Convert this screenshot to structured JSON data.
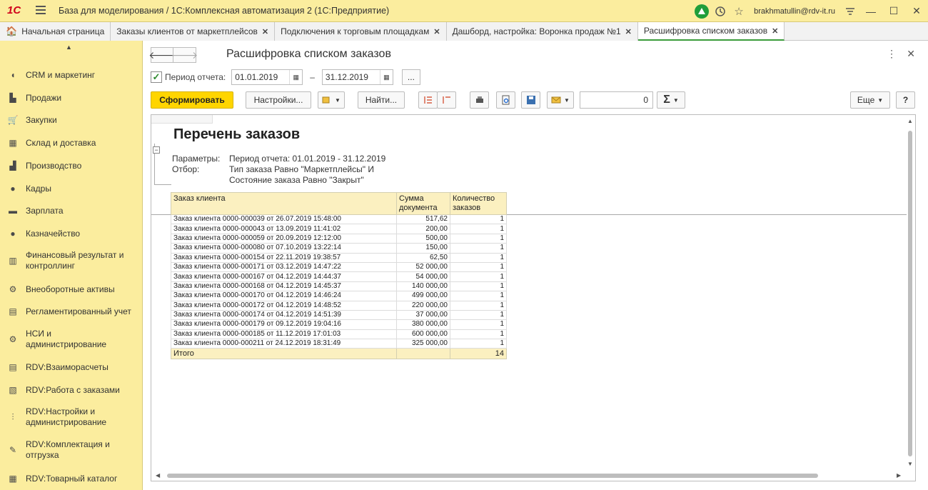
{
  "app": {
    "logo": "1С",
    "title": "База для моделирования / 1С:Комплексная автоматизация 2  (1С:Предприятие)",
    "user": "brakhmatullin@rdv-it.ru"
  },
  "tabs": [
    {
      "label": "Начальная страница",
      "closable": false
    },
    {
      "label": "Заказы клиентов от маркетплейсов",
      "closable": true
    },
    {
      "label": "Подключения к торговым площадкам",
      "closable": true
    },
    {
      "label": "Дашборд, настройка: Воронка продаж №1",
      "closable": true
    },
    {
      "label": "Расшифровка списком заказов",
      "closable": true
    }
  ],
  "sidebar": {
    "items": [
      {
        "label": "CRM и маркетинг",
        "icon": "◖"
      },
      {
        "label": "Продажи",
        "icon": "▙"
      },
      {
        "label": "Закупки",
        "icon": "🛒"
      },
      {
        "label": "Склад и доставка",
        "icon": "▦"
      },
      {
        "label": "Производство",
        "icon": "▟"
      },
      {
        "label": "Кадры",
        "icon": "●"
      },
      {
        "label": "Зарплата",
        "icon": "▬"
      },
      {
        "label": "Казначейство",
        "icon": "●"
      },
      {
        "label": "Финансовый результат и контроллинг",
        "icon": "▥"
      },
      {
        "label": "Внеоборотные активы",
        "icon": "⚙"
      },
      {
        "label": "Регламентированный учет",
        "icon": "▤"
      },
      {
        "label": "НСИ и администрирование",
        "icon": "⚙"
      },
      {
        "label": "RDV:Взаиморасчеты",
        "icon": "▤"
      },
      {
        "label": "RDV:Работа с заказами",
        "icon": "▧"
      },
      {
        "label": "RDV:Настройки и администрирование",
        "icon": "⫶"
      },
      {
        "label": "RDV:Комплектация и отгрузка",
        "icon": "✎"
      },
      {
        "label": "RDV:Товарный каталог",
        "icon": "▦"
      }
    ]
  },
  "form": {
    "title": "Расшифровка списком заказов",
    "period_label": "Период отчета:",
    "date_from": "01.01.2019",
    "date_to": "31.12.2019",
    "dash": "–",
    "dots": "...",
    "generate_button": "Сформировать",
    "settings_button": "Настройки...",
    "find_button": "Найти...",
    "sum_value": "0",
    "more_button": "Еще",
    "help_button": "?"
  },
  "report": {
    "title": "Перечень заказов",
    "params_label": "Параметры:",
    "params_value": "Период отчета: 01.01.2019 - 31.12.2019",
    "filter_label": "Отбор:",
    "filter_line1": "Тип заказа Равно \"Маркетплейсы\" И",
    "filter_line2": "Состояние заказа Равно \"Закрыт\"",
    "columns": [
      "Заказ клиента",
      "Сумма документа",
      "Количество заказов"
    ],
    "rows": [
      [
        "Заказ клиента 0000-000039 от 26.07.2019 15:48:00",
        "517,62",
        "1"
      ],
      [
        "Заказ клиента 0000-000043 от 13.09.2019 11:41:02",
        "200,00",
        "1"
      ],
      [
        "Заказ клиента 0000-000059 от 20.09.2019 12:12:00",
        "500,00",
        "1"
      ],
      [
        "Заказ клиента 0000-000080 от 07.10.2019 13:22:14",
        "150,00",
        "1"
      ],
      [
        "Заказ клиента 0000-000154 от 22.11.2019 19:38:57",
        "62,50",
        "1"
      ],
      [
        "Заказ клиента 0000-000171 от 03.12.2019 14:47:22",
        "52 000,00",
        "1"
      ],
      [
        "Заказ клиента 0000-000167 от 04.12.2019 14:44:37",
        "54 000,00",
        "1"
      ],
      [
        "Заказ клиента 0000-000168 от 04.12.2019 14:45:37",
        "140 000,00",
        "1"
      ],
      [
        "Заказ клиента 0000-000170 от 04.12.2019 14:46:24",
        "499 000,00",
        "1"
      ],
      [
        "Заказ клиента 0000-000172 от 04.12.2019 14:48:52",
        "220 000,00",
        "1"
      ],
      [
        "Заказ клиента 0000-000174 от 04.12.2019 14:51:39",
        "37 000,00",
        "1"
      ],
      [
        "Заказ клиента 0000-000179 от 09.12.2019 19:04:16",
        "380 000,00",
        "1"
      ],
      [
        "Заказ клиента 0000-000185 от 11.12.2019 17:01:03",
        "600 000,00",
        "1"
      ],
      [
        "Заказ клиента 0000-000211 от 24.12.2019 18:31:49",
        "325 000,00",
        "1"
      ]
    ],
    "total_label": "Итого",
    "total_count": "14"
  },
  "colors": {
    "accent_yellow": "#fbed9e",
    "primary_button": "#ffd500",
    "header_cell": "#fbf0c0",
    "active_tab_underline": "#3a9c3a"
  }
}
